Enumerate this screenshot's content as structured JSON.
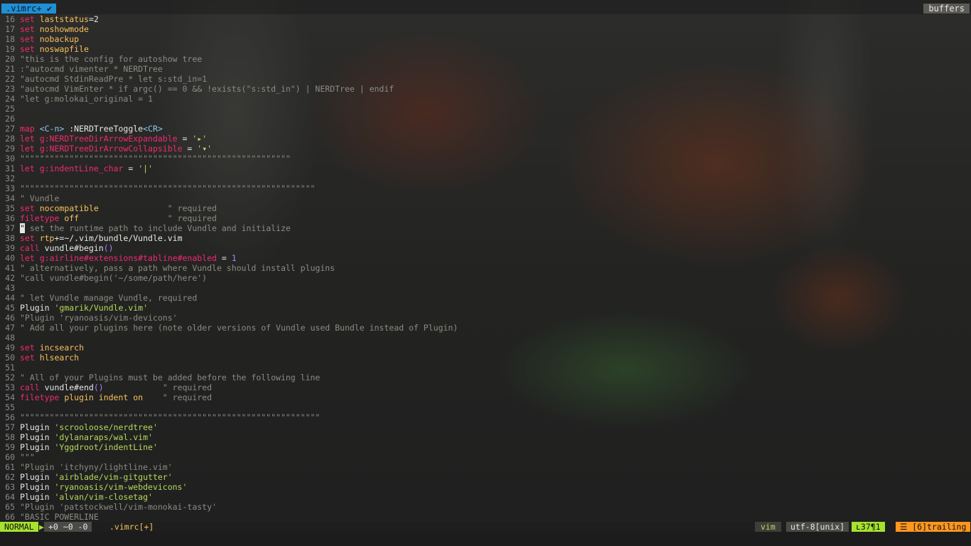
{
  "tabline": {
    "active_tab": ".vimrc+",
    "active_tab_icon": "tab-marker-icon",
    "buffers_label": "buffers"
  },
  "editor": {
    "cursor_line": 37,
    "lines": [
      {
        "n": "16",
        "segs": [
          {
            "t": "set ",
            "c": "k"
          },
          {
            "t": "laststatus",
            "c": "o"
          },
          {
            "t": "=2",
            "c": ""
          }
        ]
      },
      {
        "n": "17",
        "segs": [
          {
            "t": "set ",
            "c": "k"
          },
          {
            "t": "noshowmode",
            "c": "o"
          }
        ]
      },
      {
        "n": "18",
        "segs": [
          {
            "t": "set ",
            "c": "k"
          },
          {
            "t": "nobackup",
            "c": "o"
          }
        ]
      },
      {
        "n": "19",
        "segs": [
          {
            "t": "set ",
            "c": "k"
          },
          {
            "t": "noswapfile",
            "c": "o"
          }
        ]
      },
      {
        "n": "20",
        "segs": [
          {
            "t": "\"this is the config for autoshow tree",
            "c": "c"
          }
        ]
      },
      {
        "n": "21",
        "segs": [
          {
            "t": ":\"autocmd vimenter * NERDTree",
            "c": "c"
          }
        ]
      },
      {
        "n": "22",
        "segs": [
          {
            "t": "\"autocmd StdinReadPre * let s:std_in=1",
            "c": "c"
          }
        ]
      },
      {
        "n": "23",
        "segs": [
          {
            "t": "\"autocmd VimEnter * if argc() == 0 && !exists(\"s:std_in\") | NERDTree | endif",
            "c": "c"
          }
        ]
      },
      {
        "n": "24",
        "segs": [
          {
            "t": "\"let g:molokai_original = 1",
            "c": "c"
          }
        ]
      },
      {
        "n": "25",
        "segs": []
      },
      {
        "n": "26",
        "segs": []
      },
      {
        "n": "27",
        "segs": [
          {
            "t": "map ",
            "c": "k"
          },
          {
            "t": "<C-n>",
            "c": "sp"
          },
          {
            "t": " :NERDTreeToggle",
            "c": ""
          },
          {
            "t": "<CR>",
            "c": "sp"
          }
        ]
      },
      {
        "n": "28",
        "segs": [
          {
            "t": "let ",
            "c": "k"
          },
          {
            "t": "g:NERDTreeDirArrowExpandable",
            "c": "v"
          },
          {
            "t": " = ",
            "c": ""
          },
          {
            "t": "'▸'",
            "c": "s"
          }
        ]
      },
      {
        "n": "29",
        "segs": [
          {
            "t": "let ",
            "c": "k"
          },
          {
            "t": "g:NERDTreeDirArrowCollapsible",
            "c": "v"
          },
          {
            "t": " = ",
            "c": ""
          },
          {
            "t": "'▾'",
            "c": "s"
          }
        ]
      },
      {
        "n": "30",
        "segs": [
          {
            "t": "\"\"\"\"\"\"\"\"\"\"\"\"\"\"\"\"\"\"\"\"\"\"\"\"\"\"\"\"\"\"\"\"\"\"\"\"\"\"\"\"\"\"\"\"\"\"\"\"\"\"\"\"\"\"\"",
            "c": "c"
          }
        ]
      },
      {
        "n": "31",
        "segs": [
          {
            "t": "let ",
            "c": "k"
          },
          {
            "t": "g:indentLine_char",
            "c": "v"
          },
          {
            "t": " = ",
            "c": ""
          },
          {
            "t": "'|'",
            "c": "s"
          }
        ]
      },
      {
        "n": "32",
        "segs": []
      },
      {
        "n": "33",
        "segs": [
          {
            "t": "\"\"\"\"\"\"\"\"\"\"\"\"\"\"\"\"\"\"\"\"\"\"\"\"\"\"\"\"\"\"\"\"\"\"\"\"\"\"\"\"\"\"\"\"\"\"\"\"\"\"\"\"\"\"\"\"\"\"\"\"",
            "c": "c"
          }
        ]
      },
      {
        "n": "34",
        "segs": [
          {
            "t": "\" Vundle",
            "c": "c"
          }
        ]
      },
      {
        "n": "35",
        "segs": [
          {
            "t": "set ",
            "c": "k"
          },
          {
            "t": "nocompatible",
            "c": "o"
          },
          {
            "t": "              \" required",
            "c": "c"
          }
        ]
      },
      {
        "n": "36",
        "segs": [
          {
            "t": "filetype ",
            "c": "k"
          },
          {
            "t": "off",
            "c": "o"
          },
          {
            "t": "                  \" required",
            "c": "c"
          }
        ]
      },
      {
        "n": "37",
        "segs": [
          {
            "t": "\"",
            "c": "cur"
          },
          {
            "t": " set the runtime path to include Vundle and initialize",
            "c": "c"
          }
        ]
      },
      {
        "n": "38",
        "segs": [
          {
            "t": "set ",
            "c": "k"
          },
          {
            "t": "rtp",
            "c": "o"
          },
          {
            "t": "+=~/.vim/bundle/Vundle.vim",
            "c": ""
          }
        ]
      },
      {
        "n": "39",
        "segs": [
          {
            "t": "call ",
            "c": "k"
          },
          {
            "t": "vundle#begin",
            "c": ""
          },
          {
            "t": "()",
            "c": "n"
          }
        ]
      },
      {
        "n": "40",
        "segs": [
          {
            "t": "let ",
            "c": "k"
          },
          {
            "t": "g:airline#extensions#tabline#enabled",
            "c": "v"
          },
          {
            "t": " = ",
            "c": ""
          },
          {
            "t": "1",
            "c": "n"
          }
        ]
      },
      {
        "n": "41",
        "segs": [
          {
            "t": "\" alternatively, pass a path where Vundle should install plugins",
            "c": "c"
          }
        ]
      },
      {
        "n": "42",
        "segs": [
          {
            "t": "\"call vundle#begin('~/some/path/here')",
            "c": "c"
          }
        ]
      },
      {
        "n": "43",
        "segs": []
      },
      {
        "n": "44",
        "segs": [
          {
            "t": "\" let Vundle manage Vundle, required",
            "c": "c"
          }
        ]
      },
      {
        "n": "45",
        "segs": [
          {
            "t": "Plugin ",
            "c": ""
          },
          {
            "t": "'gmarik/Vundle.vim'",
            "c": "s"
          }
        ]
      },
      {
        "n": "46",
        "segs": [
          {
            "t": "\"Plugin 'ryanoasis/vim-devicons'",
            "c": "c"
          }
        ]
      },
      {
        "n": "47",
        "segs": [
          {
            "t": "\" Add all your plugins here (note older versions of Vundle used Bundle instead of Plugin)",
            "c": "c"
          }
        ]
      },
      {
        "n": "48",
        "segs": []
      },
      {
        "n": "49",
        "segs": [
          {
            "t": "set ",
            "c": "k"
          },
          {
            "t": "incsearch",
            "c": "o"
          }
        ]
      },
      {
        "n": "50",
        "segs": [
          {
            "t": "set ",
            "c": "k"
          },
          {
            "t": "hlsearch",
            "c": "o"
          }
        ]
      },
      {
        "n": "51",
        "segs": []
      },
      {
        "n": "52",
        "segs": [
          {
            "t": "\" All of your Plugins must be added before the following line",
            "c": "c"
          }
        ]
      },
      {
        "n": "53",
        "segs": [
          {
            "t": "call ",
            "c": "k"
          },
          {
            "t": "vundle#end",
            "c": ""
          },
          {
            "t": "()",
            "c": "n"
          },
          {
            "t": "            \" required",
            "c": "c"
          }
        ]
      },
      {
        "n": "54",
        "segs": [
          {
            "t": "filetype ",
            "c": "k"
          },
          {
            "t": "plugin indent on",
            "c": "o"
          },
          {
            "t": "    \" required",
            "c": "c"
          }
        ]
      },
      {
        "n": "55",
        "segs": []
      },
      {
        "n": "56",
        "segs": [
          {
            "t": "\"\"\"\"\"\"\"\"\"\"\"\"\"\"\"\"\"\"\"\"\"\"\"\"\"\"\"\"\"\"\"\"\"\"\"\"\"\"\"\"\"\"\"\"\"\"\"\"\"\"\"\"\"\"\"\"\"\"\"\"\"",
            "c": "c"
          }
        ]
      },
      {
        "n": "57",
        "segs": [
          {
            "t": "Plugin ",
            "c": ""
          },
          {
            "t": "'scrooloose/nerdtree'",
            "c": "s"
          }
        ]
      },
      {
        "n": "58",
        "segs": [
          {
            "t": "Plugin ",
            "c": ""
          },
          {
            "t": "'dylanaraps/wal.vim'",
            "c": "s"
          }
        ]
      },
      {
        "n": "59",
        "segs": [
          {
            "t": "Plugin ",
            "c": ""
          },
          {
            "t": "'Yggdroot/indentLine'",
            "c": "s"
          }
        ]
      },
      {
        "n": "60",
        "segs": [
          {
            "t": "\"\"\"",
            "c": "c"
          }
        ]
      },
      {
        "n": "61",
        "segs": [
          {
            "t": "\"Plugin 'itchyny/lightline.vim'",
            "c": "c"
          }
        ]
      },
      {
        "n": "62",
        "segs": [
          {
            "t": "Plugin ",
            "c": ""
          },
          {
            "t": "'airblade/vim-gitgutter'",
            "c": "s"
          }
        ]
      },
      {
        "n": "63",
        "segs": [
          {
            "t": "Plugin ",
            "c": ""
          },
          {
            "t": "'ryanoasis/vim-webdevicons'",
            "c": "s"
          }
        ]
      },
      {
        "n": "64",
        "segs": [
          {
            "t": "Plugin ",
            "c": ""
          },
          {
            "t": "'alvan/vim-closetag'",
            "c": "s"
          }
        ]
      },
      {
        "n": "65",
        "segs": [
          {
            "t": "\"Plugin 'patstockwell/vim-monokai-tasty'",
            "c": "c"
          }
        ]
      },
      {
        "n": "66",
        "segs": [
          {
            "t": "\"BASIC POWERLINE",
            "c": "c"
          }
        ]
      }
    ]
  },
  "statusline": {
    "mode": "NORMAL",
    "hunks": "+0 ~0 -0",
    "file": ".vimrc[+]",
    "filetype": "vim",
    "encoding": "utf-8[unix]",
    "position": "ʟ37¶1",
    "trailing": "☰ [6]trailing"
  },
  "colors": {
    "mode_normal": "#a6e22e",
    "tab_active": "#1f8fd6",
    "warning": "#fd971f",
    "keyword": "#f02a71",
    "option": "#f6c15b",
    "string": "#b5d95a",
    "comment": "#8b8b84"
  }
}
